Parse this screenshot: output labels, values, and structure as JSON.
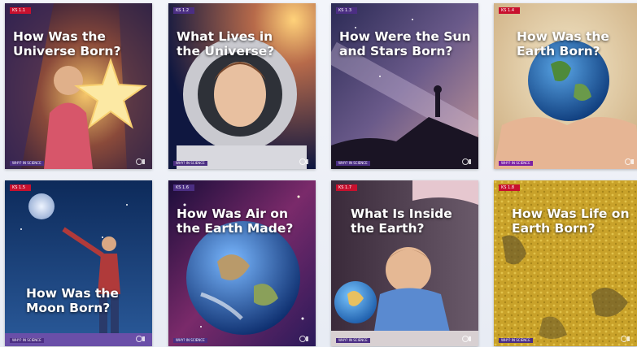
{
  "cards": [
    {
      "id": "universe",
      "tag": "KS 1.1",
      "title": "How Was the\nUniverse Born?",
      "series": "WHY? IN SCIENCE",
      "tag_color": "#c8102e",
      "series_color": "#4b2e83",
      "art": "child-with-glowing-star"
    },
    {
      "id": "lives",
      "tag": "KS 1.2",
      "title": "What Lives in\nthe Universe?",
      "series": "WHY? IN SCIENCE",
      "tag_color": "#4b2e83",
      "series_color": "#4b2e83",
      "art": "child-astronaut"
    },
    {
      "id": "sun-stars",
      "tag": "KS 1.3",
      "title": "How Were the Sun\nand Stars Born?",
      "series": "WHY? IN SCIENCE",
      "tag_color": "#4b2e83",
      "series_color": "#4b2e83",
      "art": "milky-way-silhouette"
    },
    {
      "id": "earth",
      "tag": "KS 1.4",
      "title": "How Was the\nEarth Born?",
      "series": "WHY? IN SCIENCE",
      "tag_color": "#c8102e",
      "series_color": "#7b1fa2",
      "art": "earth-in-hands"
    },
    {
      "id": "moon",
      "tag": "KS 1.5",
      "title": "How Was the\nMoon Born?",
      "series": "WHY? IN SCIENCE",
      "tag_color": "#c8102e",
      "series_color": "#4b2e83",
      "art": "boy-reaching-moon"
    },
    {
      "id": "air",
      "tag": "KS 1.6",
      "title": "How Was Air on\nthe Earth Made?",
      "series": "WHY? IN SCIENCE",
      "tag_color": "#4b2e83",
      "series_color": "#4b2e83",
      "art": "earth-from-space"
    },
    {
      "id": "inside",
      "tag": "KS 1.7",
      "title": "What Is Inside\nthe Earth?",
      "series": "WHY? IN SCIENCE",
      "tag_color": "#c8102e",
      "series_color": "#4b2e83",
      "art": "child-with-globe"
    },
    {
      "id": "life",
      "tag": "KS 1.8",
      "title": "How Was Life on\nEarth Born?",
      "series": "WHY? IN SCIENCE",
      "tag_color": "#c8102e",
      "series_color": "#4b2e83",
      "art": "golden-texture"
    }
  ]
}
